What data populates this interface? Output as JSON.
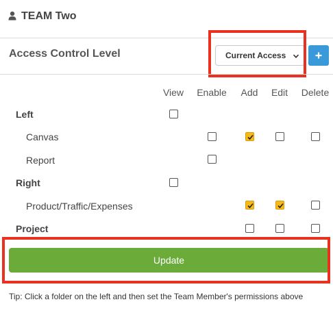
{
  "team": {
    "icon": "user-icon",
    "title": "TEAM Two"
  },
  "acl": {
    "title": "Access Control Level",
    "select_value": "Current Access",
    "add_button_label": "+"
  },
  "columns": [
    "View",
    "Enable",
    "Add",
    "Edit",
    "Delete"
  ],
  "rows": [
    {
      "label": "Left",
      "bold": true,
      "view": false
    },
    {
      "label": "Canvas",
      "bold": false,
      "enable": false,
      "add": true,
      "edit": false,
      "delete": false
    },
    {
      "label": "Report",
      "bold": false,
      "enable": false
    },
    {
      "label": "Right",
      "bold": true,
      "view": false
    },
    {
      "label": "Product/Traffic/Expenses",
      "bold": false,
      "add": true,
      "edit": true,
      "delete": false
    },
    {
      "label": "Project",
      "bold": true,
      "add": false,
      "edit": false,
      "delete": false
    }
  ],
  "update_button_label": "Update",
  "tip": "Tip: Click a folder on the left and then set the Team Member's permissions above",
  "colors": {
    "highlight": "#e8311f",
    "update": "#6aab3a",
    "add_button": "#3a9ad9",
    "checkbox_checked": "#f6b91a"
  }
}
